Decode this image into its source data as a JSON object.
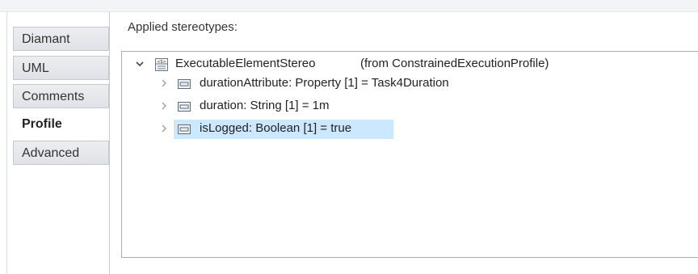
{
  "tabs": [
    {
      "label": "Diamant",
      "active": false
    },
    {
      "label": "UML",
      "active": false
    },
    {
      "label": "Comments",
      "active": false
    },
    {
      "label": "Profile",
      "active": true
    },
    {
      "label": "Advanced",
      "active": false
    }
  ],
  "content": {
    "section_label": "Applied stereotypes:",
    "tree": {
      "root": {
        "label": "ExecutableElementStereo",
        "from": "(from ConstrainedExecutionProfile)",
        "expanded": true,
        "icon": "stereotype-icon"
      },
      "children": [
        {
          "label": "durationAttribute: Property [1] = Task4Duration",
          "icon": "property-icon",
          "selected": false
        },
        {
          "label": "duration: String [1] = 1m",
          "icon": "property-icon",
          "selected": false
        },
        {
          "label": "isLogged: Boolean [1] = true",
          "icon": "property-icon",
          "selected": true
        }
      ]
    }
  },
  "colors": {
    "selection": "#cce8ff",
    "border": "#a9aeb6",
    "tab_bg": "#dfe2e7"
  }
}
